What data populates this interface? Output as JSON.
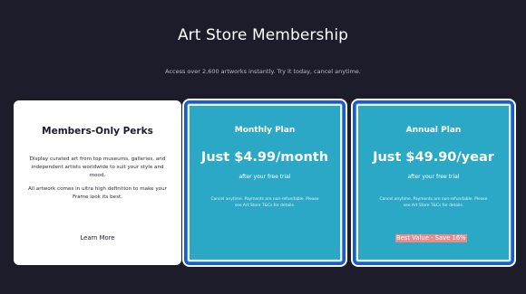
{
  "header": {
    "title": "Art Store Membership",
    "subtitle": "Access over 2,600 artworks instantly. Try it today, cancel anytime."
  },
  "perks": {
    "title": "Members-Only Perks",
    "paragraph_1": "Display curated art from top museums, galleries, and independent artists worldwide to suit your style and mood.",
    "paragraph_2": "All artwork comes in ultra high definition to make your Frame look its best.",
    "link_label": "Learn More"
  },
  "plans": [
    {
      "name": "Monthly Plan",
      "price": "Just $4.99/month",
      "trial": "after your free trial",
      "fine_print": "Cancel anytime. Payments are non-refundable. Please see Art Store T&Cs for details."
    },
    {
      "name": "Annual Plan",
      "price": "Just $49.90/year",
      "trial": "after your free trial",
      "fine_print": "Cancel anytime. Payments are non-refundable. Please see Art Store T&Cs for details.",
      "badge": "Best Value - Save 16%"
    }
  ],
  "colors": {
    "background": "#1c1c2b",
    "plan_card": "#2aa8c6",
    "selection_border": "#1f57d9",
    "badge": "#e88b8b"
  }
}
